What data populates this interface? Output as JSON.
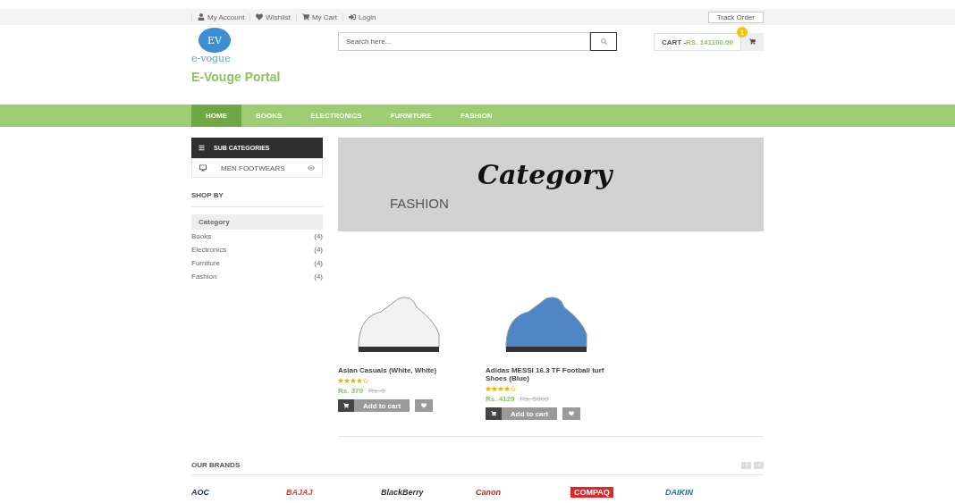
{
  "top_links": [
    {
      "label": "My Account"
    },
    {
      "label": "Wishlist"
    },
    {
      "label": "My Cart"
    },
    {
      "label": "Login"
    }
  ],
  "track_order": "Track Order",
  "logo": {
    "initials": "EV",
    "wordmark": "e-vogue",
    "portal": "E-Vouge Portal"
  },
  "search": {
    "placeholder": "Search here..."
  },
  "cart": {
    "label": "CART - ",
    "amount": "RS. 141100.00",
    "badge": "1"
  },
  "nav": [
    {
      "label": "HOME",
      "selected": true
    },
    {
      "label": "BOOKS",
      "selected": false
    },
    {
      "label": "ELECTRONICS",
      "selected": false
    },
    {
      "label": "FURNITURE",
      "selected": false
    },
    {
      "label": "FASHION",
      "selected": false
    }
  ],
  "sub_categories": {
    "title": "SUB CATEGORIES",
    "items": [
      {
        "label": "MEN FOOTWEARS"
      }
    ]
  },
  "shop_by": {
    "title": "SHOP BY",
    "filter_title": "Category",
    "items": [
      {
        "label": "Books",
        "count": "(4)"
      },
      {
        "label": "Electronics",
        "count": "(4)"
      },
      {
        "label": "Furniture",
        "count": "(4)"
      },
      {
        "label": "Fashion",
        "count": "(4)"
      }
    ]
  },
  "banner": {
    "heading": "Category",
    "subheading": "FASHION"
  },
  "products": [
    {
      "name": "Asian Casuals (White, White)",
      "stars": 4,
      "price": "Rs. 379",
      "old_price": "Rs. 0",
      "add_to_cart": "Add to cart"
    },
    {
      "name": "Adidas MESSI 16.3 TF Football turf Shoes (Blue)",
      "stars": 4,
      "price": "Rs. 4129",
      "old_price": "Rs. 5000",
      "add_to_cart": "Add to cart"
    }
  ],
  "brands": {
    "title": "OUR BRANDS",
    "items": [
      {
        "name": "AOC",
        "color": "#1b2a5c"
      },
      {
        "name": "BAJAJ",
        "color": "#e53935"
      },
      {
        "name": "BlackBerry",
        "color": "#333333"
      },
      {
        "name": "Canon",
        "color": "#cc1f1f"
      },
      {
        "name": "COMPAQ",
        "color": "#e0262b"
      },
      {
        "name": "DAIKIN",
        "color": "#1b6fb5"
      }
    ]
  }
}
